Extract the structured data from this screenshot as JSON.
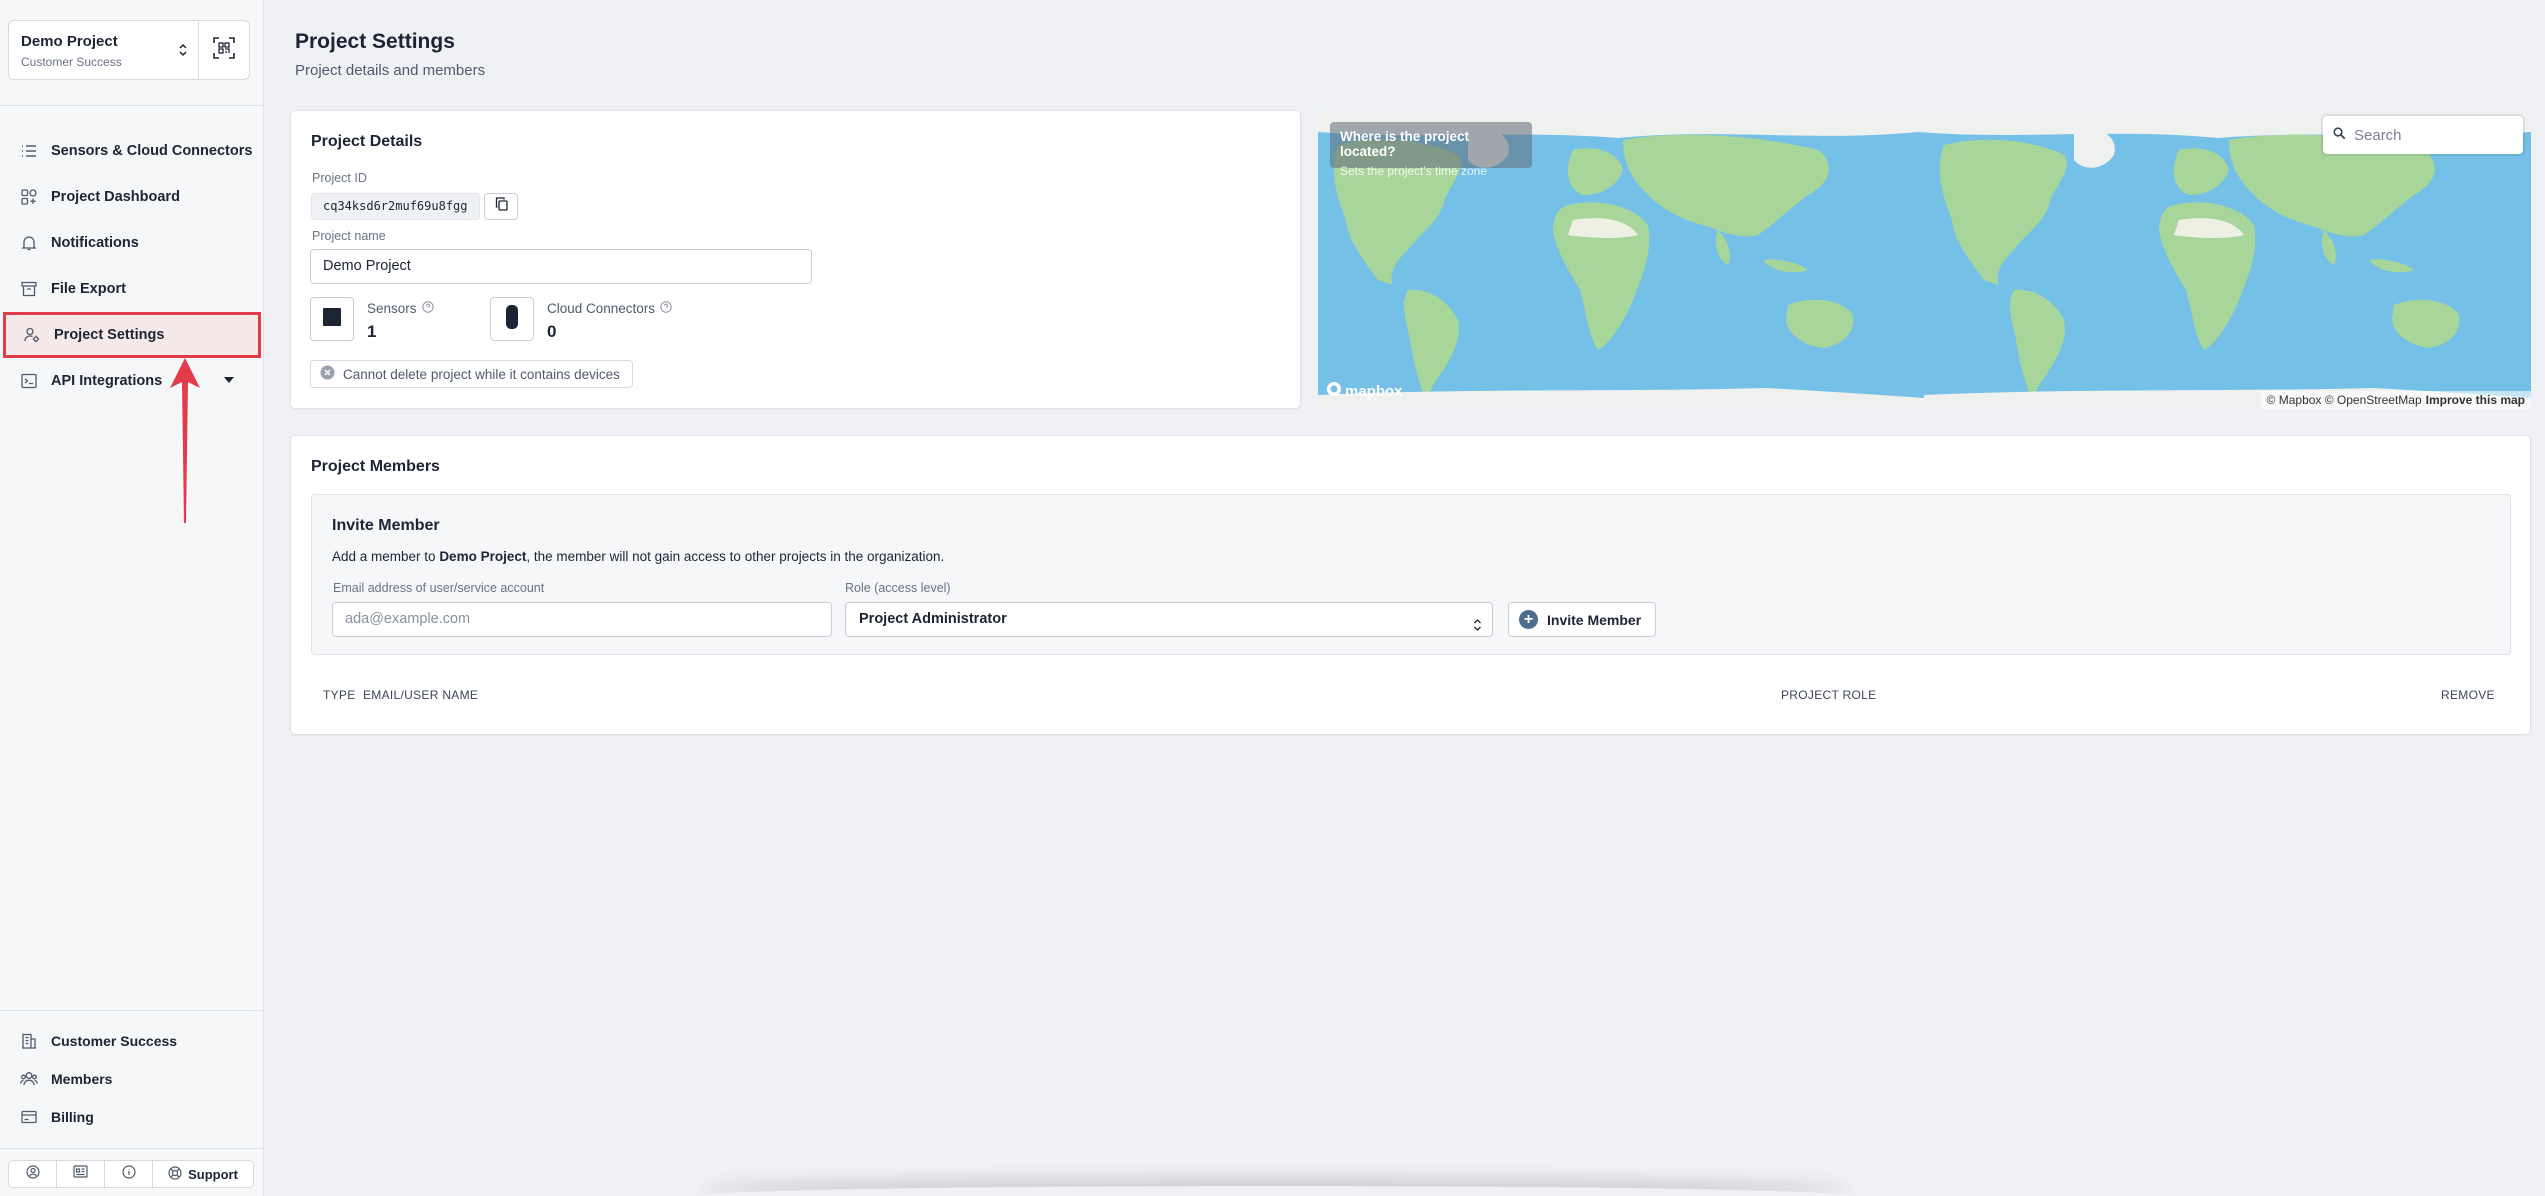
{
  "project_switcher": {
    "name": "Demo Project",
    "org": "Customer Success"
  },
  "nav": {
    "items": [
      {
        "label": "Sensors & Cloud Connectors",
        "icon": "list-icon"
      },
      {
        "label": "Project Dashboard",
        "icon": "dashboard-icon"
      },
      {
        "label": "Notifications",
        "icon": "bell-icon"
      },
      {
        "label": "File Export",
        "icon": "archive-icon"
      },
      {
        "label": "Project Settings",
        "icon": "user-settings-icon",
        "active": true
      },
      {
        "label": "API Integrations",
        "icon": "terminal-icon"
      }
    ],
    "bottom": [
      {
        "label": "Customer Success",
        "icon": "building-icon"
      },
      {
        "label": "Members",
        "icon": "users-icon"
      },
      {
        "label": "Billing",
        "icon": "card-icon"
      }
    ],
    "support_label": "Support"
  },
  "page": {
    "title": "Project Settings",
    "subtitle": "Project details and members"
  },
  "details": {
    "title": "Project Details",
    "id_label": "Project ID",
    "project_id": "cq34ksd6r2muf69u8fgg",
    "name_label": "Project name",
    "name_value": "Demo Project",
    "sensors_label": "Sensors",
    "sensors_count": "1",
    "connectors_label": "Cloud Connectors",
    "connectors_count": "0",
    "warning": "Cannot delete project while it contains devices"
  },
  "map": {
    "tip_title": "Where is the project located?",
    "tip_sub": "Sets the project's time zone",
    "search_placeholder": "Search",
    "logo": "mapbox",
    "attribution": "© Mapbox © OpenStreetMap",
    "improve": "Improve this map",
    "colors": {
      "water": "#74c0e6",
      "land": "#a8d69a",
      "ice": "#eef1ee"
    }
  },
  "members": {
    "title": "Project Members",
    "invite_title": "Invite Member",
    "invite_desc_pre": "Add a member to ",
    "invite_desc_project": "Demo Project",
    "invite_desc_post": ", the member will not gain access to other projects in the organization.",
    "email_label": "Email address of user/service account",
    "email_placeholder": "ada@example.com",
    "role_label": "Role (access level)",
    "role_value": "Project Administrator",
    "invite_button": "Invite Member",
    "columns": {
      "type": "TYPE",
      "email": "EMAIL/USER NAME",
      "role": "PROJECT ROLE",
      "remove": "REMOVE"
    }
  },
  "accent": "#e23b49"
}
